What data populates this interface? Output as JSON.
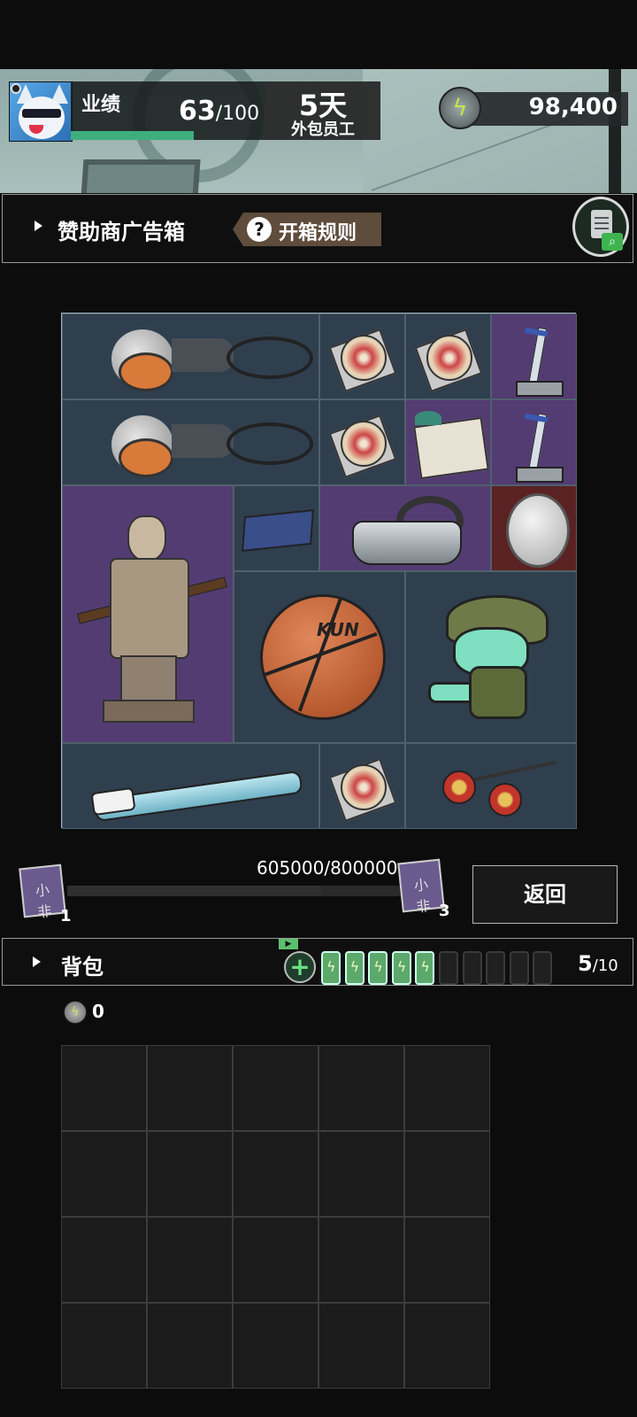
{
  "header": {
    "performance_label": "业绩",
    "performance_current": "63",
    "performance_max": "/100",
    "performance_ratio": 0.63,
    "days": "5天",
    "employee_type": "外包员工",
    "currency_value": "98,400",
    "currency_icon": "lightning-coin-icon"
  },
  "sponsor": {
    "title": "赞助商广告箱",
    "rules_label": "开箱规则",
    "clipboard_icon": "clipboard-search-icon"
  },
  "box_items": [
    {
      "name": "hair-dryer",
      "icon": "hair-dryer-icon",
      "rarity": "common"
    },
    {
      "name": "cd-disc",
      "icon": "cd-disc-icon",
      "rarity": "common"
    },
    {
      "name": "cd-disc",
      "icon": "cd-disc-icon",
      "rarity": "common"
    },
    {
      "name": "sword-trophy",
      "icon": "sword-trophy-icon",
      "rarity": "epic"
    },
    {
      "name": "hair-dryer",
      "icon": "hair-dryer-icon",
      "rarity": "common"
    },
    {
      "name": "cd-disc",
      "icon": "cd-disc-icon",
      "rarity": "common"
    },
    {
      "name": "postcard",
      "icon": "postcard-icon",
      "rarity": "epic"
    },
    {
      "name": "sword-trophy",
      "icon": "sword-trophy-icon",
      "rarity": "epic"
    },
    {
      "name": "terracotta-warrior",
      "icon": "terracotta-warrior-icon",
      "rarity": "epic"
    },
    {
      "name": "ssd-drive",
      "icon": "ssd-drive-icon",
      "rarity": "common"
    },
    {
      "name": "vr-headset",
      "icon": "vr-headset-icon",
      "rarity": "epic"
    },
    {
      "name": "silver-coin",
      "icon": "silver-coin-icon",
      "rarity": "legendary"
    },
    {
      "name": "basketball",
      "icon": "basketball-icon",
      "rarity": "common",
      "text": "KUN"
    },
    {
      "name": "frog-character",
      "icon": "frog-character-icon",
      "rarity": "common"
    },
    {
      "name": "electric-toothbrush",
      "icon": "toothbrush-icon",
      "rarity": "common"
    },
    {
      "name": "cd-disc",
      "icon": "cd-disc-icon",
      "rarity": "common"
    },
    {
      "name": "flail-maces",
      "icon": "flail-mace-icon",
      "rarity": "common"
    }
  ],
  "progress": {
    "text": "605000/800000",
    "ratio": 0.75625,
    "left_ticket_icon": "ticket-icon",
    "left_ticket_glyph": "小非",
    "left_level": "1",
    "right_ticket_icon": "ticket-icon",
    "right_ticket_glyph": "小非",
    "right_level": "3",
    "back_label": "返回"
  },
  "backpack": {
    "title": "背包",
    "ad_flag": "▶",
    "add_symbol": "+",
    "battery_icon": "battery-icon",
    "batteries_filled": 5,
    "batteries_total": 10,
    "count": "5",
    "capacity": "/10",
    "coin_value": "0",
    "coin_icon": "lightning-coin-icon"
  },
  "colors": {
    "background": "#0c0c0c",
    "grid_blue": "#2f3f4e",
    "epic_purple": "#533c72",
    "legendary_red": "#5a2222",
    "performance_green": "#3fae7e",
    "battery_green": "#5ca96b",
    "rules_brown": "#5e4c3c"
  }
}
